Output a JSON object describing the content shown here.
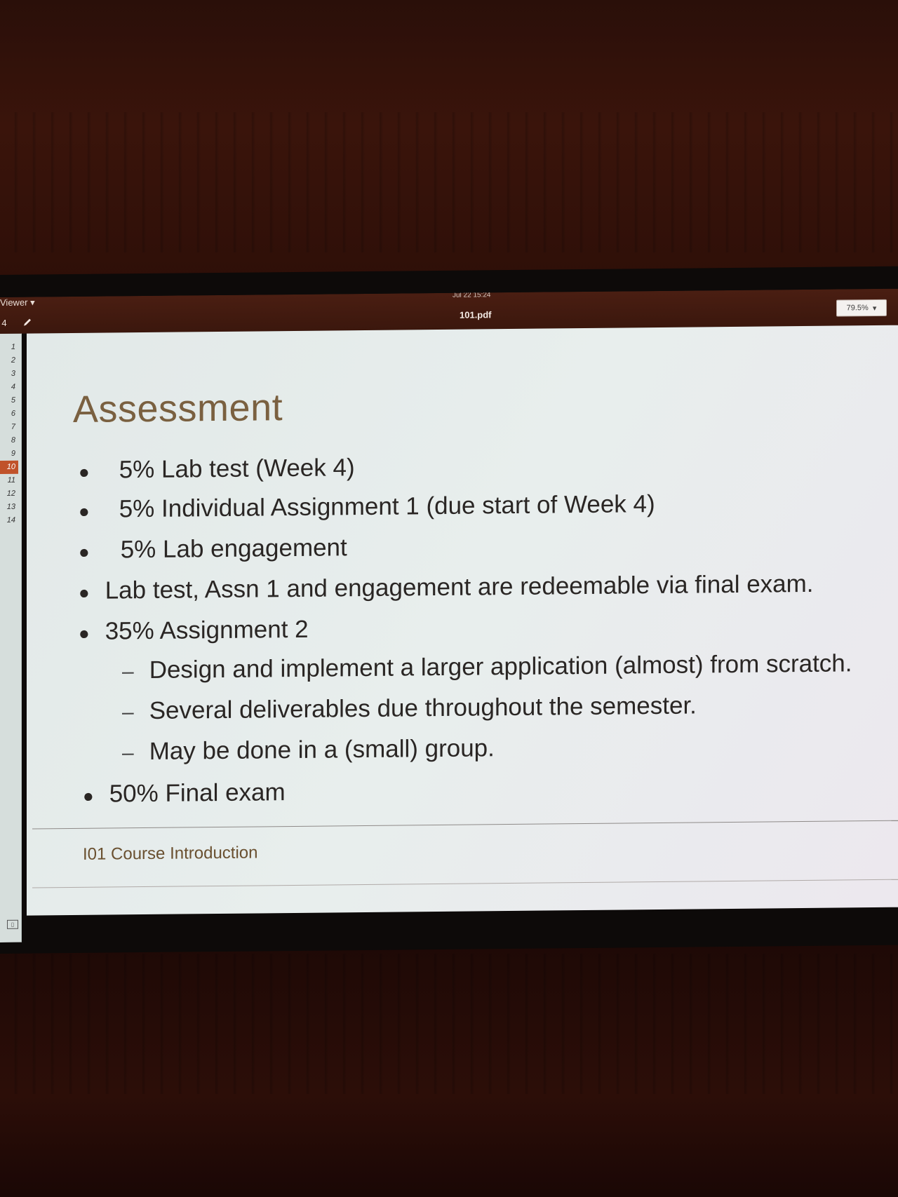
{
  "app": {
    "menu_label": "Viewer ▾",
    "clock": "Jul 22 15:24"
  },
  "toolbar": {
    "page_field": "4",
    "annotate_icon": "pencil-icon",
    "document_title": "101.pdf",
    "zoom": "79.5%",
    "zoom_arrow": "▾"
  },
  "sidebar": {
    "pages": [
      "1",
      "2",
      "3",
      "4",
      "5",
      "6",
      "7",
      "8",
      "9",
      "10",
      "11",
      "12",
      "13",
      "14"
    ],
    "active_page": "10"
  },
  "slide": {
    "title": "Assessment",
    "bullets": [
      "5% Lab test (Week 4)",
      "5% Individual Assignment 1 (due start of Week 4)",
      "5% Lab engagement",
      "Lab test, Assn 1 and engagement are redeemable via final exam.",
      "35% Assignment 2"
    ],
    "sub_bullets": [
      "Design and implement a larger application (almost) from scratch.",
      "Several deliverables due throughout the semester.",
      "May be done in a (small) group."
    ],
    "last_bullet": "50% Final exam",
    "footer": "I01 Course Introduction"
  },
  "colors": {
    "accent": "#c0522a",
    "title": "#7a6040",
    "topbar": "#3b170d"
  }
}
